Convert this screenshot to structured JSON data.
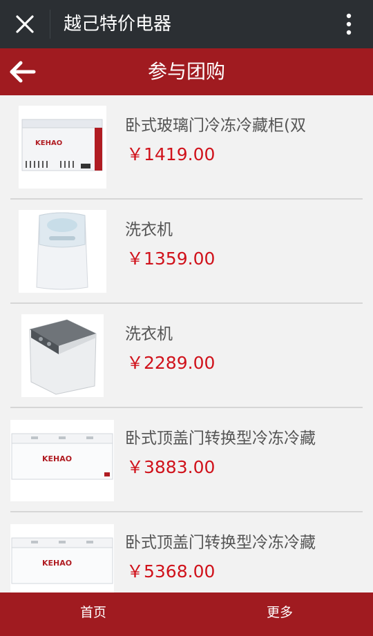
{
  "topbar": {
    "title": "越己特价电器"
  },
  "header": {
    "title": "参与团购"
  },
  "products": [
    {
      "name": "卧式玻璃门冷冻冷藏柜(双",
      "price": "￥1419.00",
      "image": "chest-freezer-glass-door"
    },
    {
      "name": "洗衣机",
      "price": "￥1359.00",
      "image": "washing-machine-white"
    },
    {
      "name": "洗衣机",
      "price": "￥2289.00",
      "image": "washing-machine-top-load"
    },
    {
      "name": "卧式顶盖门转换型冷冻冷藏",
      "price": "￥3883.00",
      "image": "chest-freezer-top-door"
    },
    {
      "name": "卧式顶盖门转换型冷冻冷藏",
      "price": "￥5368.00",
      "image": "chest-freezer-top-door"
    }
  ],
  "brand_logo": "KEHAO科豪",
  "bottombar": {
    "home": "首页",
    "more": "更多"
  },
  "colors": {
    "topbar": "#2b2f33",
    "header": "#a01b20",
    "price": "#d0121b"
  }
}
